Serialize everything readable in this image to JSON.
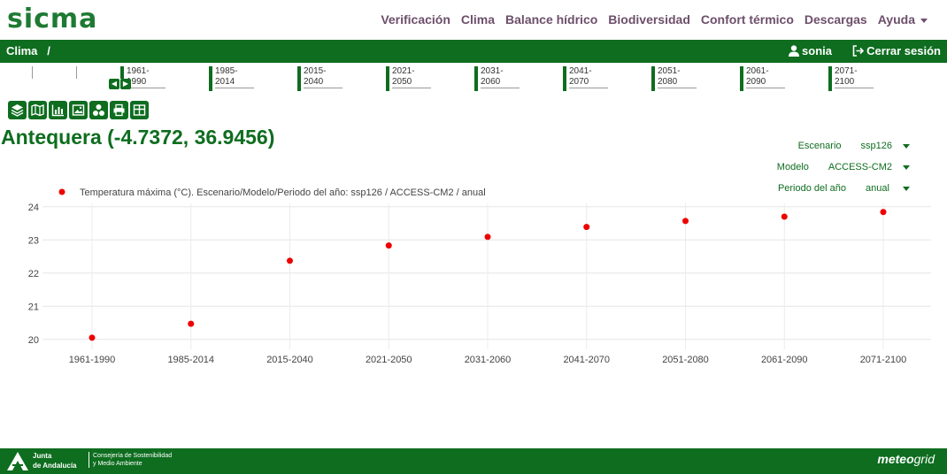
{
  "logo": {
    "text": "sicma"
  },
  "nav": {
    "items": [
      "Verificación",
      "Clima",
      "Balance hídrico",
      "Biodiversidad",
      "Confort térmico",
      "Descargas"
    ],
    "help": "Ayuda"
  },
  "breadcrumb": {
    "section": "Clima",
    "separator": "/"
  },
  "user": {
    "name": "sonia",
    "logout": "Cerrar sesión"
  },
  "timeline": {
    "periods": [
      "1961-1990",
      "1985-2014",
      "2015-2040",
      "2021-2050",
      "2031-2060",
      "2041-2070",
      "2051-2080",
      "2061-2090",
      "2071-2100"
    ]
  },
  "toolbar": {
    "icons": [
      "layers-icon",
      "map-icon",
      "bar-chart-icon",
      "image-icon",
      "network-icon",
      "print-icon",
      "table-icon"
    ]
  },
  "location": {
    "title": "Antequera (-4.7372, 36.9456)"
  },
  "selectors": [
    {
      "label": "Escenario",
      "value": "ssp126"
    },
    {
      "label": "Modelo",
      "value": "ACCESS-CM2"
    },
    {
      "label": "Periodo del año",
      "value": "anual"
    }
  ],
  "chart_data": {
    "type": "scatter",
    "legend": "Temperatura máxima (°C). Escenario/Modelo/Periodo del año: ssp126 / ACCESS-CM2 / anual",
    "categories": [
      "1961-1990",
      "1985-2014",
      "2015-2040",
      "2021-2050",
      "2031-2060",
      "2041-2070",
      "2051-2080",
      "2061-2090",
      "2071-2100"
    ],
    "values": [
      20.05,
      20.47,
      22.37,
      22.83,
      23.09,
      23.39,
      23.57,
      23.7,
      23.84
    ],
    "yticks": [
      20,
      21,
      22,
      23,
      24
    ],
    "ylim": [
      19.7,
      24.1
    ],
    "color": "#ee0000"
  },
  "footer": {
    "junta_line1": "Junta",
    "junta_line2": "de Andalucía",
    "consejeria_line1": "Consejería de Sostenibilidad",
    "consejeria_line2": "y Medio Ambiente",
    "brand_a": "meteo",
    "brand_b": "grid"
  },
  "colors": {
    "primary_green": "#0e6d1f",
    "nav_text": "#6d4f6b",
    "point_red": "#ee0000"
  }
}
